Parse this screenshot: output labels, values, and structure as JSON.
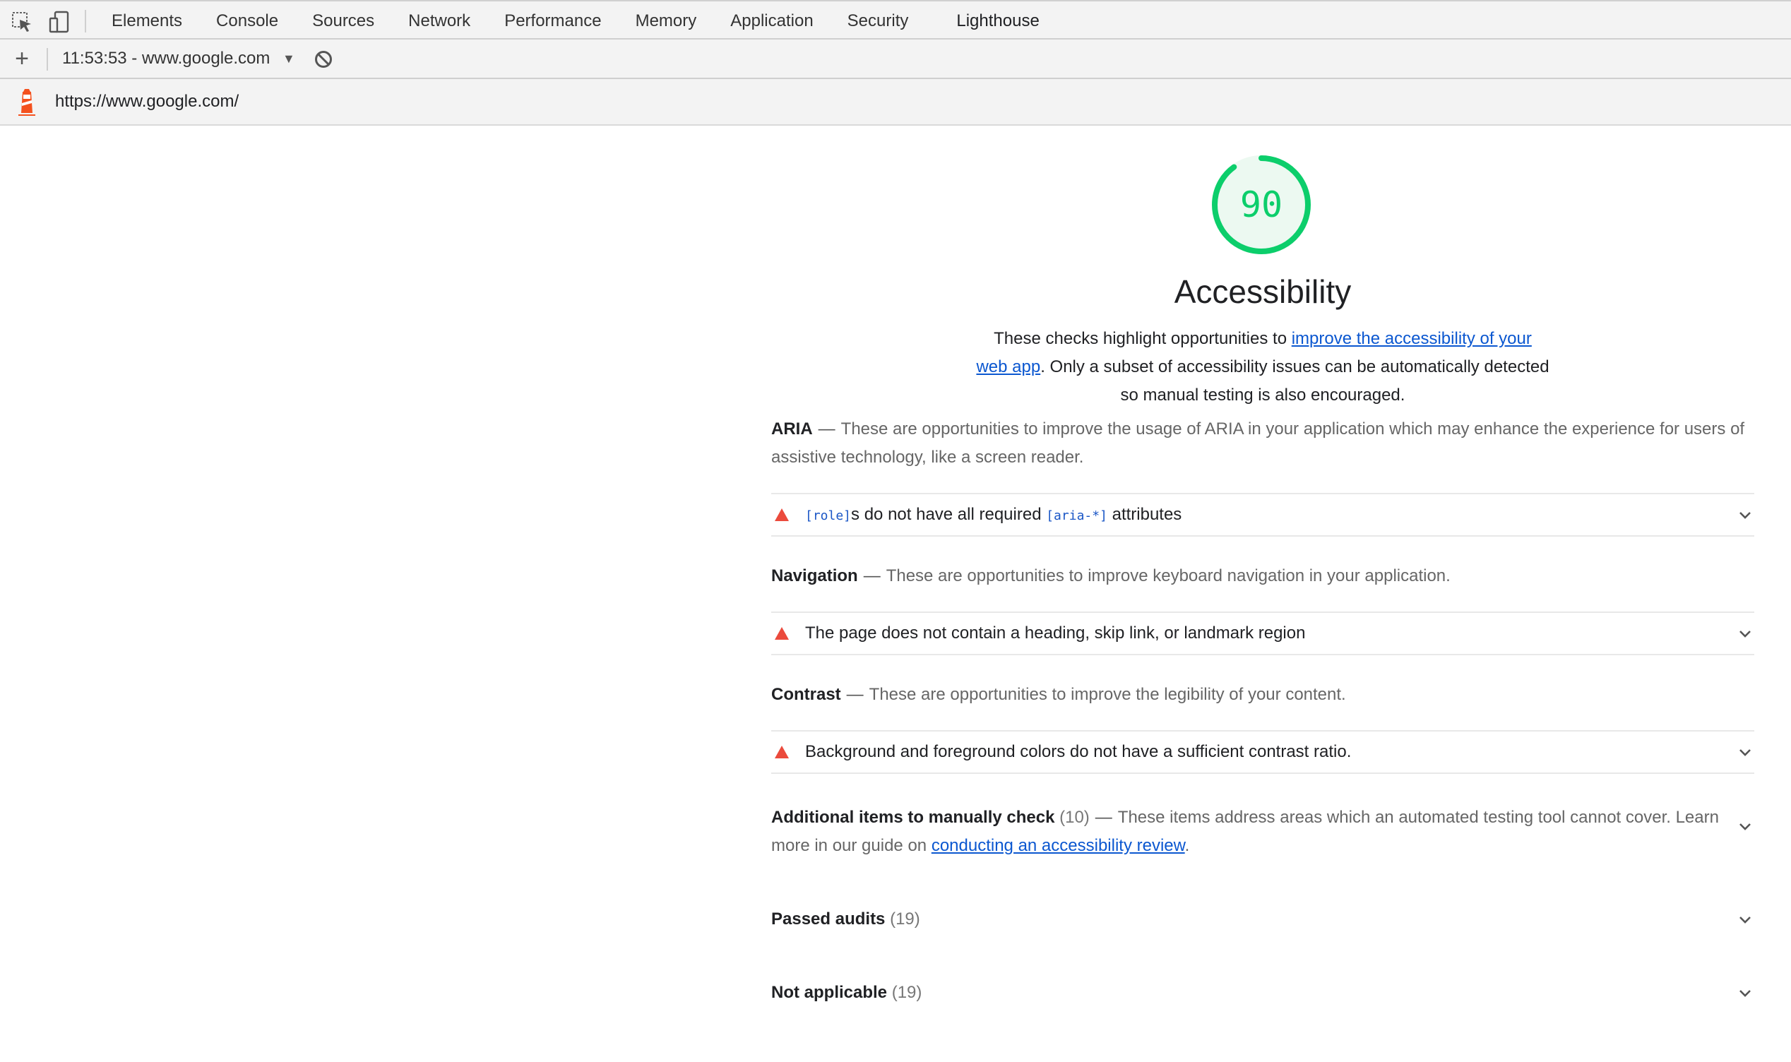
{
  "devtools": {
    "tabs": [
      {
        "label": "Elements"
      },
      {
        "label": "Console"
      },
      {
        "label": "Sources"
      },
      {
        "label": "Network"
      },
      {
        "label": "Performance"
      },
      {
        "label": "Memory"
      },
      {
        "label": "Application"
      },
      {
        "label": "Security"
      },
      {
        "label": "Lighthouse"
      }
    ],
    "active_tab": "Lighthouse",
    "accent_color": "#1a73e8"
  },
  "toolbar": {
    "new_icon": "plus-icon",
    "session": "11:53:53 - www.google.com",
    "dropdown_icon": "triangle-down-icon",
    "clear_icon": "block-icon"
  },
  "urlbar": {
    "logo": "lighthouse-logo",
    "url": "https://www.google.com/"
  },
  "report": {
    "score": "90",
    "score_color": "#0cce6b",
    "category_title": "Accessibility",
    "description": {
      "before": "These checks highlight opportunities to ",
      "link": "improve the accessibility of your web app",
      "after": ". Only a subset of accessibility issues can be automatically detected so manual testing is also encouraged."
    },
    "groups": [
      {
        "title": "ARIA",
        "dash": "—",
        "description": "These are opportunities to improve the usage of ARIA in your application which may enhance the experience for users of assistive technology, like a screen reader.",
        "audit": {
          "code1": "[role]",
          "text1": "s do not have all required ",
          "code2": "[aria-*]",
          "text2": " attributes"
        }
      },
      {
        "title": "Navigation",
        "dash": "—",
        "description": "These are opportunities to improve keyboard navigation in your application.",
        "audit": {
          "text": "The page does not contain a heading, skip link, or landmark region"
        }
      },
      {
        "title": "Contrast",
        "dash": "—",
        "description": "These are opportunities to improve the legibility of your content.",
        "audit": {
          "text": "Background and foreground colors do not have a sufficient contrast ratio."
        }
      }
    ],
    "manual": {
      "title": "Additional items to manually check",
      "count": "(10)",
      "dash": "—",
      "description": "These items address areas which an automated testing tool cannot cover. Learn more in our guide on ",
      "link": "conducting an accessibility review",
      "after": "."
    },
    "passed": {
      "title": "Passed audits",
      "count": "(19)"
    },
    "not_applicable": {
      "title": "Not applicable",
      "count": "(19)"
    },
    "fail_color": "#eb4a3c"
  }
}
